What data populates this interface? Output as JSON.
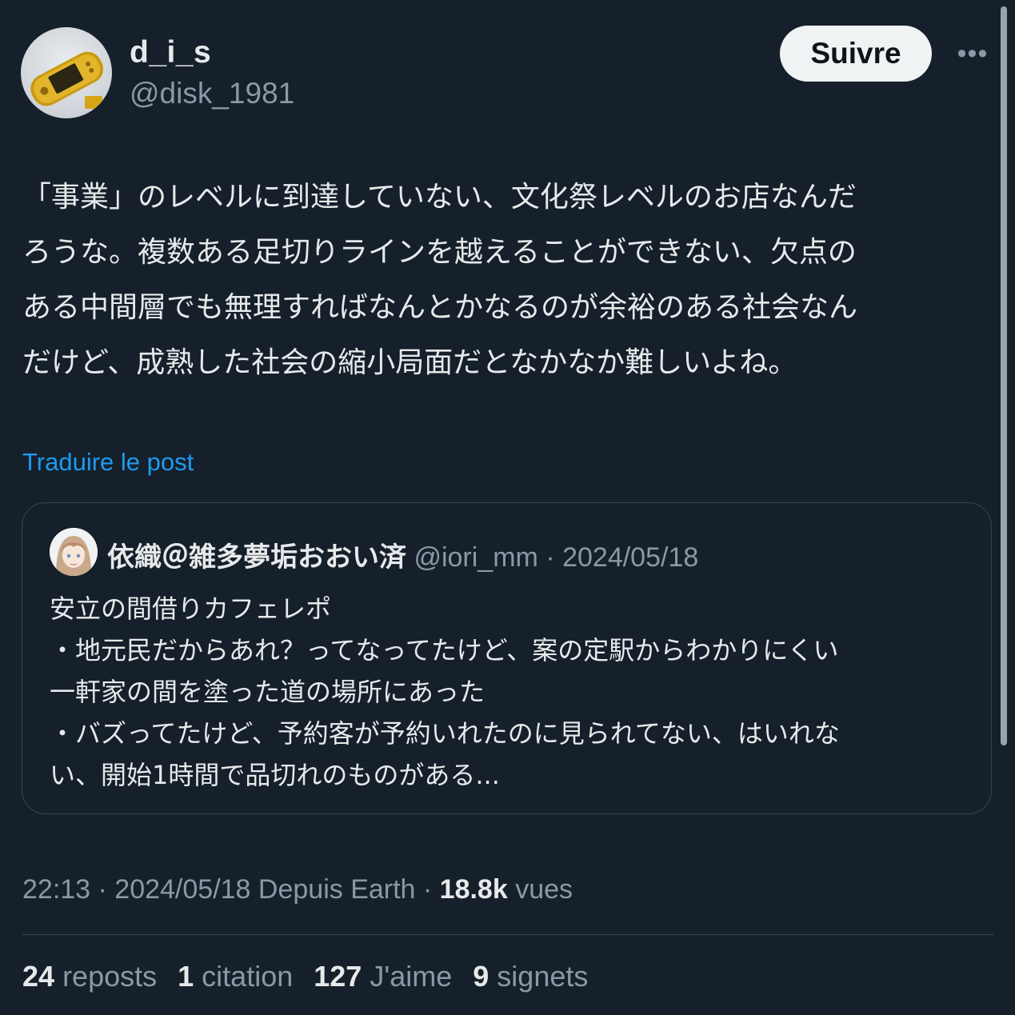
{
  "author": {
    "display_name": "d_i_s",
    "handle": "@disk_1981",
    "avatar_icon": "handheld-console-avatar"
  },
  "follow_label": "Suivre",
  "more_label": "•••",
  "tweet_text": "「事業」のレベルに到達していない、文化祭レベルのお店なんだ\nろうな。複数ある足切りラインを越えることができない、欠点の\nある中間層でも無理すればなんとかなるのが余裕のある社会なん\nだけど、成熟した社会の縮小局面だとなかなか難しいよね。",
  "translate_label": "Traduire le post",
  "quote": {
    "display_name": "依織＠雑多夢垢おおい済",
    "handle": "@iori_mm",
    "separator": " · ",
    "date": "2024/05/18",
    "avatar_icon": "anime-girl-avatar",
    "text": "安立の間借りカフェレポ\n・地元民だからあれ？ってなってたけど、案の定駅からわかりにくい\n一軒家の間を塗った道の場所にあった\n・バズってたけど、予約客が予約いれたのに見られてない、はいれな\nい、開始1時間で品切れのものがある..."
  },
  "meta": {
    "time_date_source": "22:13 · 2024/05/18 Depuis Earth · ",
    "views_count": "18.8k",
    "views_label": " vues"
  },
  "stats": [
    {
      "num": "24",
      "label": "reposts"
    },
    {
      "num": "1",
      "label": "citation"
    },
    {
      "num": "127",
      "label": "J'aime"
    },
    {
      "num": "9",
      "label": "signets"
    }
  ],
  "colors": {
    "background": "#15202b",
    "text": "#e7e9ea",
    "muted": "#8b98a5",
    "link": "#1d9bf0",
    "border": "#38444d",
    "button_bg": "#eff3f4"
  }
}
